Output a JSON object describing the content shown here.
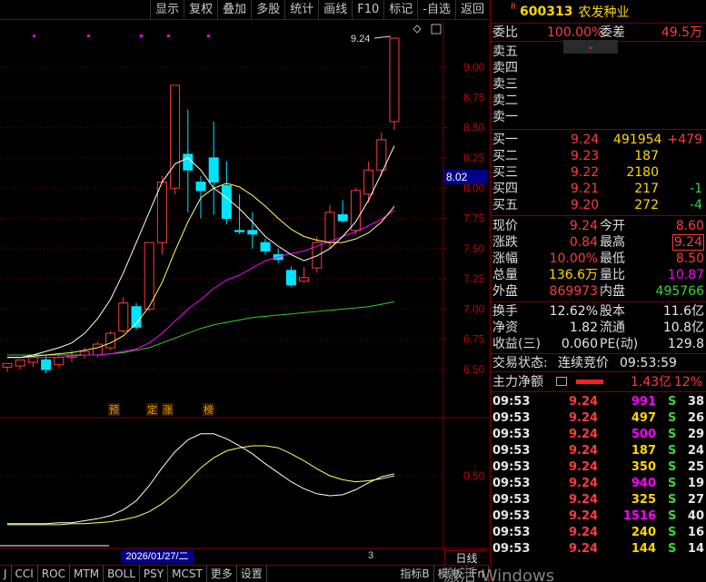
{
  "toolbar": {
    "items": [
      "显示",
      "复权",
      "叠加",
      "多股",
      "统计",
      "画线",
      "F10",
      "标记",
      "-自选",
      "返回"
    ]
  },
  "chart": {
    "price_ticks": [
      "9.00",
      "8.75",
      "8.50",
      "8.25",
      "8.00",
      "7.75",
      "7.50",
      "7.25",
      "7.00",
      "6.75",
      "6.50"
    ],
    "sub_tick": "0.50",
    "high_label": "9.24",
    "current_price": "8.02",
    "markers": [
      "预",
      "定",
      "涨",
      "榜"
    ],
    "date_tag": "2026/01/27/二",
    "cursor_index": "3",
    "period": "日线",
    "colors": {
      "up": "#ff3b3b",
      "down": "#00e5ff",
      "ma5": "#ffffff",
      "ma10": "#ffff66",
      "ma20": "#ff00ff",
      "ma60": "#33cc33",
      "grid": "#800000"
    },
    "candles": [
      [
        6.52,
        6.55,
        6.48,
        6.54
      ],
      [
        6.53,
        6.58,
        6.5,
        6.56
      ],
      [
        6.56,
        6.6,
        6.52,
        6.58
      ],
      [
        6.58,
        6.5,
        6.47,
        6.62
      ],
      [
        6.54,
        6.6,
        6.52,
        6.62
      ],
      [
        6.6,
        6.62,
        6.56,
        6.66
      ],
      [
        6.62,
        6.65,
        6.59,
        6.68
      ],
      [
        6.62,
        6.71,
        6.6,
        6.73
      ],
      [
        6.68,
        6.8,
        6.66,
        6.82
      ],
      [
        6.82,
        7.05,
        6.8,
        7.1
      ],
      [
        7.02,
        6.85,
        6.83,
        7.05
      ],
      [
        7.0,
        7.55,
        6.98,
        7.55
      ],
      [
        7.55,
        8.05,
        7.45,
        8.1
      ],
      [
        8.0,
        8.85,
        7.95,
        8.85
      ],
      [
        8.28,
        8.15,
        7.8,
        8.65
      ],
      [
        8.05,
        7.98,
        7.75,
        8.1
      ],
      [
        8.25,
        8.05,
        7.78,
        8.55
      ],
      [
        8.02,
        7.75,
        7.7,
        8.22
      ],
      [
        7.65,
        7.64,
        7.62,
        7.95
      ],
      [
        7.65,
        7.62,
        7.5,
        7.8
      ],
      [
        7.55,
        7.48,
        7.45,
        7.58
      ],
      [
        7.45,
        7.41,
        7.38,
        7.5
      ],
      [
        7.32,
        7.2,
        7.18,
        7.35
      ],
      [
        7.23,
        7.26,
        7.22,
        7.35
      ],
      [
        7.34,
        7.55,
        7.3,
        7.6
      ],
      [
        7.55,
        7.8,
        7.5,
        7.86
      ],
      [
        7.78,
        7.73,
        7.72,
        7.9
      ],
      [
        7.65,
        7.98,
        7.62,
        8.0
      ],
      [
        7.95,
        8.15,
        7.88,
        8.22
      ],
      [
        8.15,
        8.4,
        8.1,
        8.46
      ],
      [
        8.55,
        9.24,
        8.48,
        9.24
      ]
    ],
    "ma5": [
      6.6,
      6.6,
      6.62,
      6.65,
      6.68,
      6.72,
      6.8,
      6.92,
      7.08,
      7.3,
      7.55,
      7.8,
      8.05,
      8.2,
      8.25,
      8.15,
      8.0,
      7.92,
      7.83,
      7.72,
      7.6,
      7.52,
      7.45,
      7.4,
      7.44,
      7.5,
      7.6,
      7.72,
      7.9,
      8.12,
      8.35
    ],
    "ma10": [
      6.6,
      6.6,
      6.61,
      6.62,
      6.63,
      6.64,
      6.66,
      6.68,
      6.72,
      6.78,
      6.88,
      7.02,
      7.22,
      7.48,
      7.72,
      7.92,
      8.0,
      8.04,
      8.01,
      7.94,
      7.85,
      7.75,
      7.66,
      7.6,
      7.57,
      7.55,
      7.55,
      7.58,
      7.63,
      7.72,
      7.85
    ],
    "ma20": [
      6.6,
      6.6,
      6.6,
      6.6,
      6.6,
      6.61,
      6.62,
      6.62,
      6.63,
      6.65,
      6.67,
      6.72,
      6.8,
      6.9,
      7.0,
      7.08,
      7.17,
      7.24,
      7.28,
      7.34,
      7.4,
      7.43,
      7.46,
      7.48,
      7.52,
      7.56,
      7.6,
      7.64,
      7.69,
      7.74,
      7.82
    ],
    "ma60": [
      6.62,
      6.62,
      6.62,
      6.62,
      6.62,
      6.62,
      6.62,
      6.62,
      6.63,
      6.64,
      6.66,
      6.68,
      6.72,
      6.76,
      6.8,
      6.84,
      6.87,
      6.89,
      6.91,
      6.93,
      6.94,
      6.95,
      6.96,
      6.97,
      6.98,
      6.99,
      7.0,
      7.01,
      7.02,
      7.04,
      7.06
    ],
    "sub_a": [
      0.02,
      0.02,
      0.02,
      0.02,
      0.03,
      0.03,
      0.05,
      0.07,
      0.1,
      0.16,
      0.25,
      0.4,
      0.58,
      0.74,
      0.86,
      0.92,
      0.92,
      0.87,
      0.8,
      0.72,
      0.62,
      0.53,
      0.44,
      0.37,
      0.32,
      0.3,
      0.31,
      0.36,
      0.43,
      0.49,
      0.52
    ],
    "sub_b": [
      0.01,
      0.01,
      0.01,
      0.01,
      0.01,
      0.02,
      0.02,
      0.03,
      0.04,
      0.06,
      0.09,
      0.14,
      0.22,
      0.32,
      0.45,
      0.58,
      0.68,
      0.75,
      0.78,
      0.8,
      0.8,
      0.78,
      0.72,
      0.65,
      0.57,
      0.5,
      0.46,
      0.44,
      0.45,
      0.47,
      0.5
    ]
  },
  "bottom_tabs": [
    "J",
    "CCI",
    "ROC",
    "MTM",
    "BOLL",
    "PSY",
    "MCST",
    "更多",
    "设置",
    "指标B",
    "模 板",
    "Fn"
  ],
  "quote": {
    "r_mark": "R",
    "code": "600313",
    "name": "农发种业",
    "weibi_label": "委比",
    "weibi": "100.00%",
    "weicha_label": "委差",
    "weicha": "49.5万",
    "collapse_icon": "⌄",
    "sells": [
      {
        "label": "卖五"
      },
      {
        "label": "卖四"
      },
      {
        "label": "卖三"
      },
      {
        "label": "卖二"
      },
      {
        "label": "卖一"
      }
    ],
    "buys": [
      {
        "label": "买一",
        "price": "9.24",
        "vol": "491954",
        "chg": "+479",
        "chg_color": "red"
      },
      {
        "label": "买二",
        "price": "9.23",
        "vol": "187",
        "chg": "",
        "chg_color": "red"
      },
      {
        "label": "买三",
        "price": "9.22",
        "vol": "2180",
        "chg": "",
        "chg_color": "red"
      },
      {
        "label": "买四",
        "price": "9.21",
        "vol": "217",
        "chg": "-1",
        "chg_color": "green"
      },
      {
        "label": "买五",
        "price": "9.20",
        "vol": "272",
        "chg": "-4",
        "chg_color": "green"
      }
    ],
    "stats": [
      {
        "l1": "现价",
        "v1": "9.24",
        "c1": "red",
        "l2": "今开",
        "v2": "8.60",
        "c2": "red"
      },
      {
        "l1": "涨跌",
        "v1": "0.84",
        "c1": "red",
        "l2": "最高",
        "v2": "9.24",
        "c2": "red",
        "box2": true
      },
      {
        "l1": "涨幅",
        "v1": "10.00%",
        "c1": "red",
        "l2": "最低",
        "v2": "8.50",
        "c2": "red"
      },
      {
        "l1": "总量",
        "v1": "136.6万",
        "c1": "yel",
        "l2": "量比",
        "v2": "10.87",
        "c2": "mag"
      },
      {
        "l1": "外盘",
        "v1": "869973",
        "c1": "red",
        "l2": "内盘",
        "v2": "495766",
        "c2": "green"
      }
    ],
    "fund": [
      {
        "l1": "换手",
        "v1": "12.62%",
        "l2": "股本",
        "v2": "11.6亿"
      },
      {
        "l1": "净资",
        "v1": "1.82",
        "l2": "流通",
        "v2": "10.8亿"
      },
      {
        "l1": "收益(三)",
        "v1": "0.060",
        "l2": "PE(动)",
        "v2": "129.8"
      }
    ],
    "trade_status_label": "交易状态:",
    "trade_status": "连续竞价",
    "trade_time": "09:53:59",
    "main_flow_label": "主力净额",
    "main_flow": "1.43亿",
    "main_flow_pct": "12%",
    "ticks": [
      {
        "t": "09:53",
        "p": "9.24",
        "v": "991",
        "vc": "mag",
        "s": "S",
        "n": "38"
      },
      {
        "t": "09:53",
        "p": "9.24",
        "v": "497",
        "vc": "yel",
        "s": "S",
        "n": "26"
      },
      {
        "t": "09:53",
        "p": "9.24",
        "v": "500",
        "vc": "mag",
        "s": "S",
        "n": "29"
      },
      {
        "t": "09:53",
        "p": "9.24",
        "v": "187",
        "vc": "yel",
        "s": "S",
        "n": "24"
      },
      {
        "t": "09:53",
        "p": "9.24",
        "v": "350",
        "vc": "yel",
        "s": "S",
        "n": "25"
      },
      {
        "t": "09:53",
        "p": "9.24",
        "v": "940",
        "vc": "mag",
        "s": "S",
        "n": "19"
      },
      {
        "t": "09:53",
        "p": "9.24",
        "v": "325",
        "vc": "yel",
        "s": "S",
        "n": "27"
      },
      {
        "t": "09:53",
        "p": "9.24",
        "v": "1516",
        "vc": "mag",
        "s": "S",
        "n": "40"
      },
      {
        "t": "09:53",
        "p": "9.24",
        "v": "240",
        "vc": "yel",
        "s": "S",
        "n": "16"
      },
      {
        "t": "09:53",
        "p": "9.24",
        "v": "144",
        "vc": "yel",
        "s": "S",
        "n": "14"
      }
    ]
  },
  "watermark": "激活 Windows"
}
